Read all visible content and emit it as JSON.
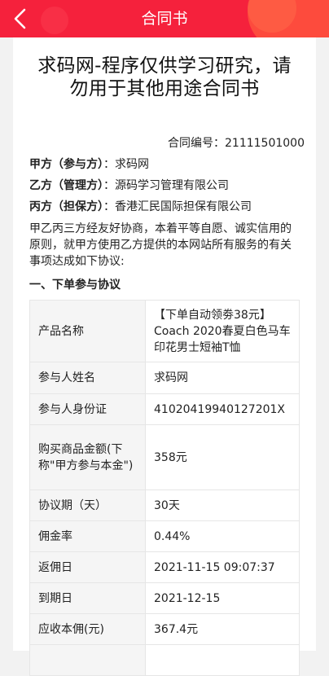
{
  "header": {
    "title": "合同书",
    "back_icon": "chevron-left-icon",
    "colors": {
      "bar": "#f5213c",
      "accent": "#ff5a3d"
    }
  },
  "document": {
    "title": "求码网-程序仅供学习研究，请勿用于其他用途合同书",
    "contract_no_label": "合同编号：",
    "contract_no": "21111501000",
    "parties": [
      {
        "label": "甲方（参与方）",
        "sep": "：",
        "value": "求码网"
      },
      {
        "label": "乙方（管理方）",
        "sep": "：",
        "value": "源码学习管理有限公司"
      },
      {
        "label": "丙方（担保方）",
        "sep": "：",
        "value": "香港汇民国际担保有限公司"
      }
    ],
    "intro": "甲乙丙三方经友好协商，本着平等自愿、诚实信用的原则，就甲方使用乙方提供的本网站所有服务的有关事项达成如下协议:",
    "section_title": "一、下单参与协议"
  },
  "table": {
    "rows": [
      {
        "key": "产品名称",
        "value": "【下单自动领劵38元】Coach 2020春夏白色马车印花男士短袖T恤"
      },
      {
        "key": "参与人姓名",
        "value": "求码网"
      },
      {
        "key": "参与人身份证",
        "value": "41020419940127201X"
      },
      {
        "key": "购买商品金额(下称\"甲方参与本金\")",
        "value": "358元"
      },
      {
        "key": "协议期（天）",
        "value": "30天"
      },
      {
        "key": "佣金率",
        "value": "0.44%"
      },
      {
        "key": "返佣日",
        "value": "2021-11-15 09:07:37"
      },
      {
        "key": "到期日",
        "value": "2021-12-15"
      },
      {
        "key": "应收本佣(元)",
        "value": "367.4元"
      },
      {
        "key": "",
        "value": ""
      }
    ]
  }
}
